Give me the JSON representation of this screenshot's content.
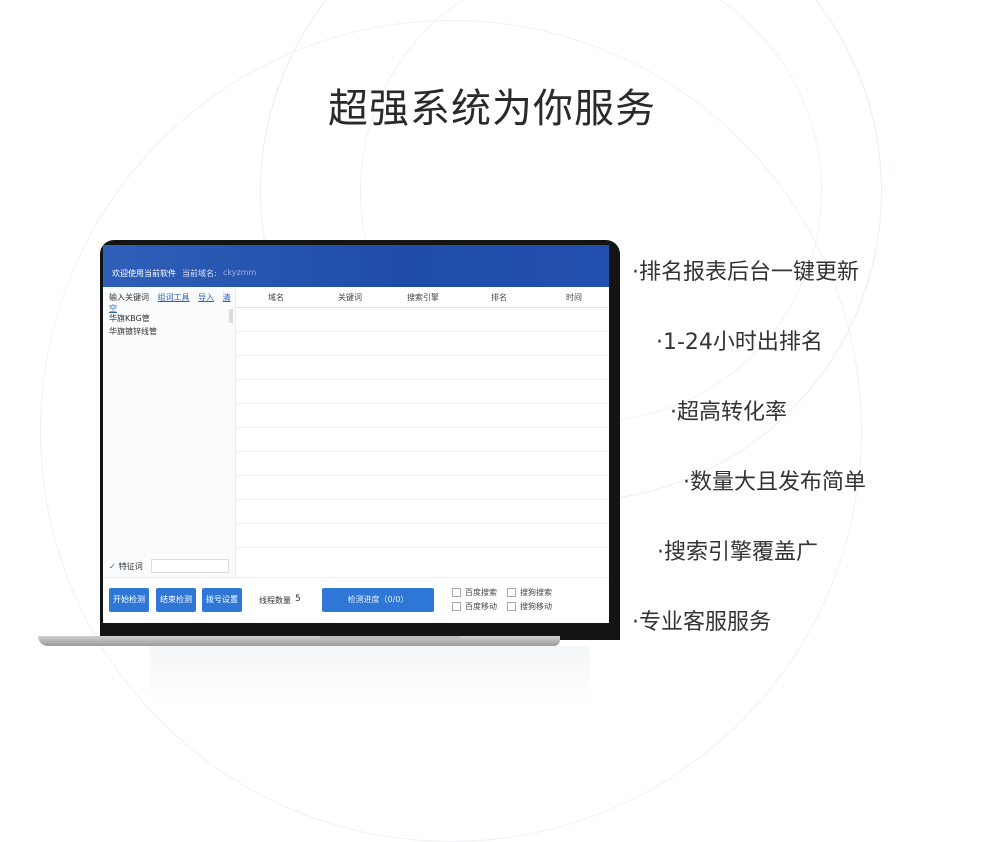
{
  "title": "超强系统为你服务",
  "features": [
    "·排名报表后台一键更新",
    "·1-24小时出排名",
    "·超高转化率",
    "·数量大且发布简单",
    "·搜索引擎覆盖广",
    "·专业客服服务"
  ],
  "app": {
    "header": {
      "welcome": "欢迎使用当前软件",
      "domain_label": "当前域名:",
      "domain_value": "ckyzmm"
    },
    "left_panel": {
      "label": "输入关键词",
      "links": [
        "组词工具",
        "导入",
        "清空"
      ],
      "keywords": [
        "华旗KBG管",
        "华旗镀锌线管"
      ],
      "feature_label": "特征词"
    },
    "table": {
      "columns": [
        "域名",
        "关键词",
        "搜索引擎",
        "排名",
        "时间"
      ]
    },
    "bottom": {
      "start_button": "开始检测",
      "stop_button": "结束检测",
      "dial_button": "拨号设置",
      "threads_label": "线程数量",
      "threads_value": "5",
      "progress_button": "检测进度（0/0）",
      "engines": [
        "百度搜索",
        "搜狗搜索",
        "百度移动",
        "搜狗移动"
      ]
    }
  }
}
